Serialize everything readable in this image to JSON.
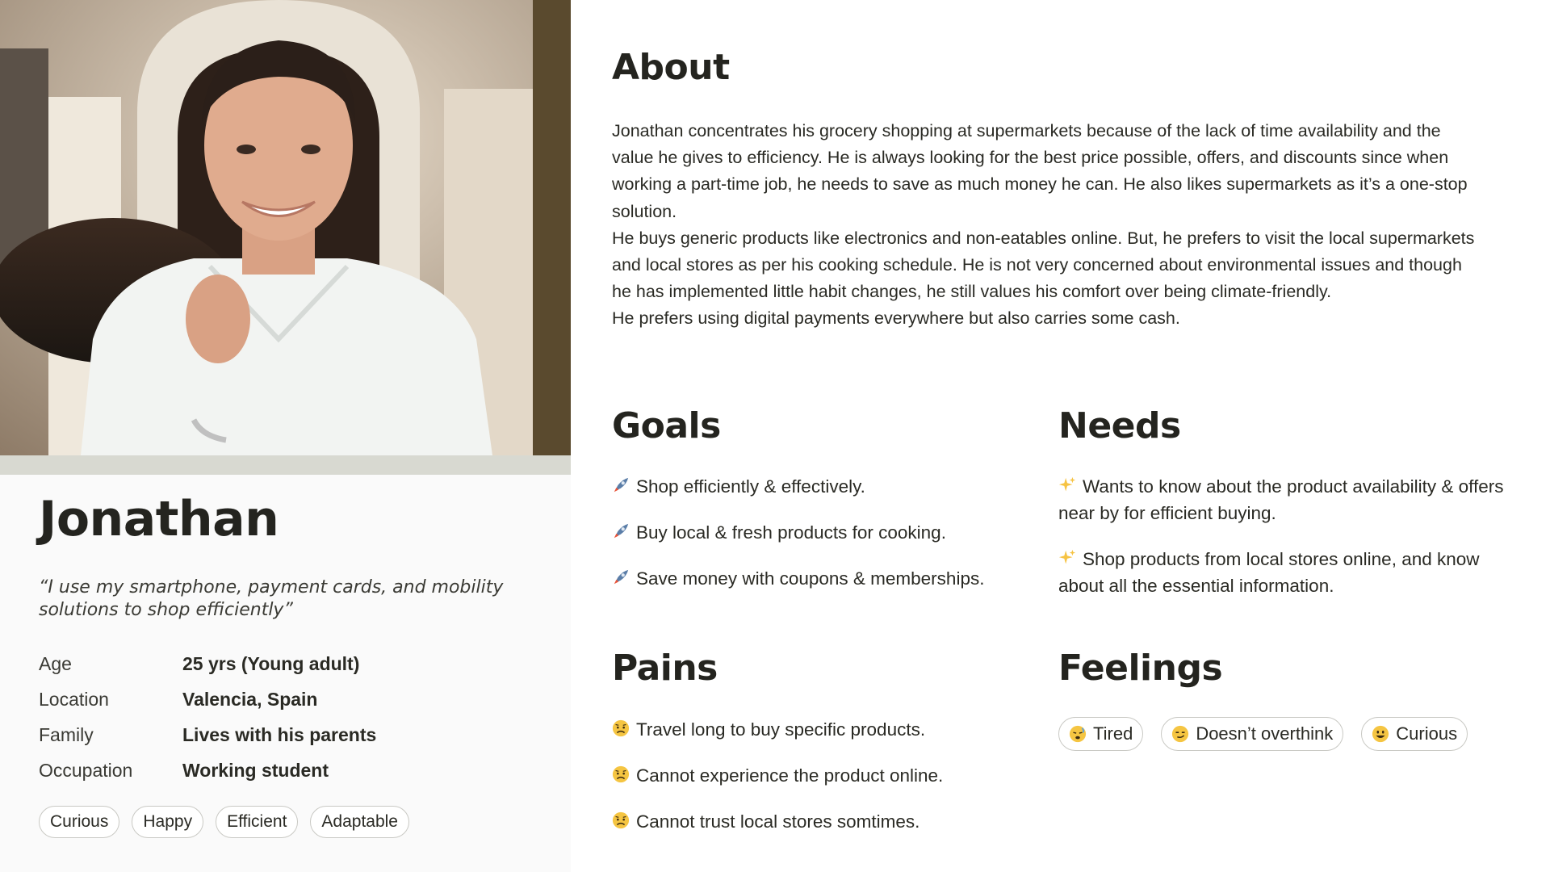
{
  "profile": {
    "name": "Jonathan",
    "quote": "“I use my smartphone, payment cards, and mobility solutions to shop efficiently”",
    "facts": [
      {
        "label": "Age",
        "value": "25 yrs (Young adult)"
      },
      {
        "label": "Location",
        "value": "Valencia, Spain"
      },
      {
        "label": "Family",
        "value": "Lives with his parents"
      },
      {
        "label": "Occupation",
        "value": "Working student"
      }
    ],
    "traits": [
      "Curious",
      "Happy",
      "Efficient",
      "Adaptable"
    ]
  },
  "about": {
    "heading": "About",
    "paragraphs": [
      "Jonathan concentrates his grocery shopping at supermarkets because of the lack of time availability and the value he gives to efficiency. He is always looking for the best price possible, offers, and discounts since when working a part-time job, he needs to save as much money he can. He also likes supermarkets as it’s a one-stop solution.",
      "He buys generic products like electronics and non-eatables online. But, he prefers to visit the local supermarkets and local stores as per his cooking schedule. He is not very concerned about environmental issues and though he has implemented little habit changes, he still values his comfort over being climate-friendly.",
      "He prefers using digital payments everywhere but also carries some cash."
    ]
  },
  "goals": {
    "heading": "Goals",
    "icon": "rocket-icon",
    "items": [
      "Shop efficiently & effectively.",
      "Buy local & fresh products for cooking.",
      "Save money with coupons & memberships."
    ]
  },
  "needs": {
    "heading": "Needs",
    "icon": "sparkles-icon",
    "items": [
      "Wants to know about the product availability & offers near by for efficient buying.",
      "Shop products from local stores online, and know about all the essential information."
    ]
  },
  "pains": {
    "heading": "Pains",
    "icon": "worried-face-icon",
    "items": [
      "Travel long to buy specific products.",
      "Cannot experience the product online.",
      "Cannot trust local stores somtimes."
    ]
  },
  "feelings": {
    "heading": "Feelings",
    "items": [
      {
        "label": "Tired",
        "icon": "tired-face-icon"
      },
      {
        "label": "Doesn’t overthink",
        "icon": "smirk-face-icon"
      },
      {
        "label": "Curious",
        "icon": "grinning-face-icon"
      }
    ]
  },
  "colors": {
    "text": "#2a2a24",
    "panel": "#fafafa",
    "strip": "#d8d9d1",
    "pill_border": "#c9c9c4"
  }
}
